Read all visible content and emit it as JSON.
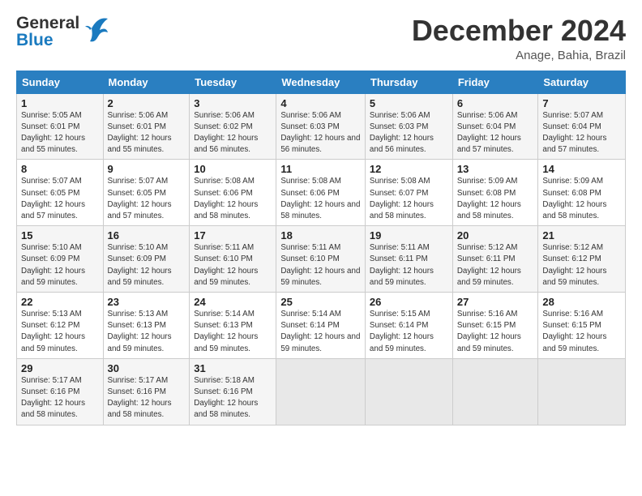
{
  "header": {
    "logo_general": "General",
    "logo_blue": "Blue",
    "month_title": "December 2024",
    "location": "Anage, Bahia, Brazil"
  },
  "weekdays": [
    "Sunday",
    "Monday",
    "Tuesday",
    "Wednesday",
    "Thursday",
    "Friday",
    "Saturday"
  ],
  "weeks": [
    [
      {
        "day": "1",
        "sunrise": "5:05 AM",
        "sunset": "6:01 PM",
        "daylight": "12 hours and 55 minutes."
      },
      {
        "day": "2",
        "sunrise": "5:06 AM",
        "sunset": "6:01 PM",
        "daylight": "12 hours and 55 minutes."
      },
      {
        "day": "3",
        "sunrise": "5:06 AM",
        "sunset": "6:02 PM",
        "daylight": "12 hours and 56 minutes."
      },
      {
        "day": "4",
        "sunrise": "5:06 AM",
        "sunset": "6:03 PM",
        "daylight": "12 hours and 56 minutes."
      },
      {
        "day": "5",
        "sunrise": "5:06 AM",
        "sunset": "6:03 PM",
        "daylight": "12 hours and 56 minutes."
      },
      {
        "day": "6",
        "sunrise": "5:06 AM",
        "sunset": "6:04 PM",
        "daylight": "12 hours and 57 minutes."
      },
      {
        "day": "7",
        "sunrise": "5:07 AM",
        "sunset": "6:04 PM",
        "daylight": "12 hours and 57 minutes."
      }
    ],
    [
      {
        "day": "8",
        "sunrise": "5:07 AM",
        "sunset": "6:05 PM",
        "daylight": "12 hours and 57 minutes."
      },
      {
        "day": "9",
        "sunrise": "5:07 AM",
        "sunset": "6:05 PM",
        "daylight": "12 hours and 57 minutes."
      },
      {
        "day": "10",
        "sunrise": "5:08 AM",
        "sunset": "6:06 PM",
        "daylight": "12 hours and 58 minutes."
      },
      {
        "day": "11",
        "sunrise": "5:08 AM",
        "sunset": "6:06 PM",
        "daylight": "12 hours and 58 minutes."
      },
      {
        "day": "12",
        "sunrise": "5:08 AM",
        "sunset": "6:07 PM",
        "daylight": "12 hours and 58 minutes."
      },
      {
        "day": "13",
        "sunrise": "5:09 AM",
        "sunset": "6:08 PM",
        "daylight": "12 hours and 58 minutes."
      },
      {
        "day": "14",
        "sunrise": "5:09 AM",
        "sunset": "6:08 PM",
        "daylight": "12 hours and 58 minutes."
      }
    ],
    [
      {
        "day": "15",
        "sunrise": "5:10 AM",
        "sunset": "6:09 PM",
        "daylight": "12 hours and 59 minutes."
      },
      {
        "day": "16",
        "sunrise": "5:10 AM",
        "sunset": "6:09 PM",
        "daylight": "12 hours and 59 minutes."
      },
      {
        "day": "17",
        "sunrise": "5:11 AM",
        "sunset": "6:10 PM",
        "daylight": "12 hours and 59 minutes."
      },
      {
        "day": "18",
        "sunrise": "5:11 AM",
        "sunset": "6:10 PM",
        "daylight": "12 hours and 59 minutes."
      },
      {
        "day": "19",
        "sunrise": "5:11 AM",
        "sunset": "6:11 PM",
        "daylight": "12 hours and 59 minutes."
      },
      {
        "day": "20",
        "sunrise": "5:12 AM",
        "sunset": "6:11 PM",
        "daylight": "12 hours and 59 minutes."
      },
      {
        "day": "21",
        "sunrise": "5:12 AM",
        "sunset": "6:12 PM",
        "daylight": "12 hours and 59 minutes."
      }
    ],
    [
      {
        "day": "22",
        "sunrise": "5:13 AM",
        "sunset": "6:12 PM",
        "daylight": "12 hours and 59 minutes."
      },
      {
        "day": "23",
        "sunrise": "5:13 AM",
        "sunset": "6:13 PM",
        "daylight": "12 hours and 59 minutes."
      },
      {
        "day": "24",
        "sunrise": "5:14 AM",
        "sunset": "6:13 PM",
        "daylight": "12 hours and 59 minutes."
      },
      {
        "day": "25",
        "sunrise": "5:14 AM",
        "sunset": "6:14 PM",
        "daylight": "12 hours and 59 minutes."
      },
      {
        "day": "26",
        "sunrise": "5:15 AM",
        "sunset": "6:14 PM",
        "daylight": "12 hours and 59 minutes."
      },
      {
        "day": "27",
        "sunrise": "5:16 AM",
        "sunset": "6:15 PM",
        "daylight": "12 hours and 59 minutes."
      },
      {
        "day": "28",
        "sunrise": "5:16 AM",
        "sunset": "6:15 PM",
        "daylight": "12 hours and 59 minutes."
      }
    ],
    [
      {
        "day": "29",
        "sunrise": "5:17 AM",
        "sunset": "6:16 PM",
        "daylight": "12 hours and 58 minutes."
      },
      {
        "day": "30",
        "sunrise": "5:17 AM",
        "sunset": "6:16 PM",
        "daylight": "12 hours and 58 minutes."
      },
      {
        "day": "31",
        "sunrise": "5:18 AM",
        "sunset": "6:16 PM",
        "daylight": "12 hours and 58 minutes."
      },
      null,
      null,
      null,
      null
    ]
  ]
}
